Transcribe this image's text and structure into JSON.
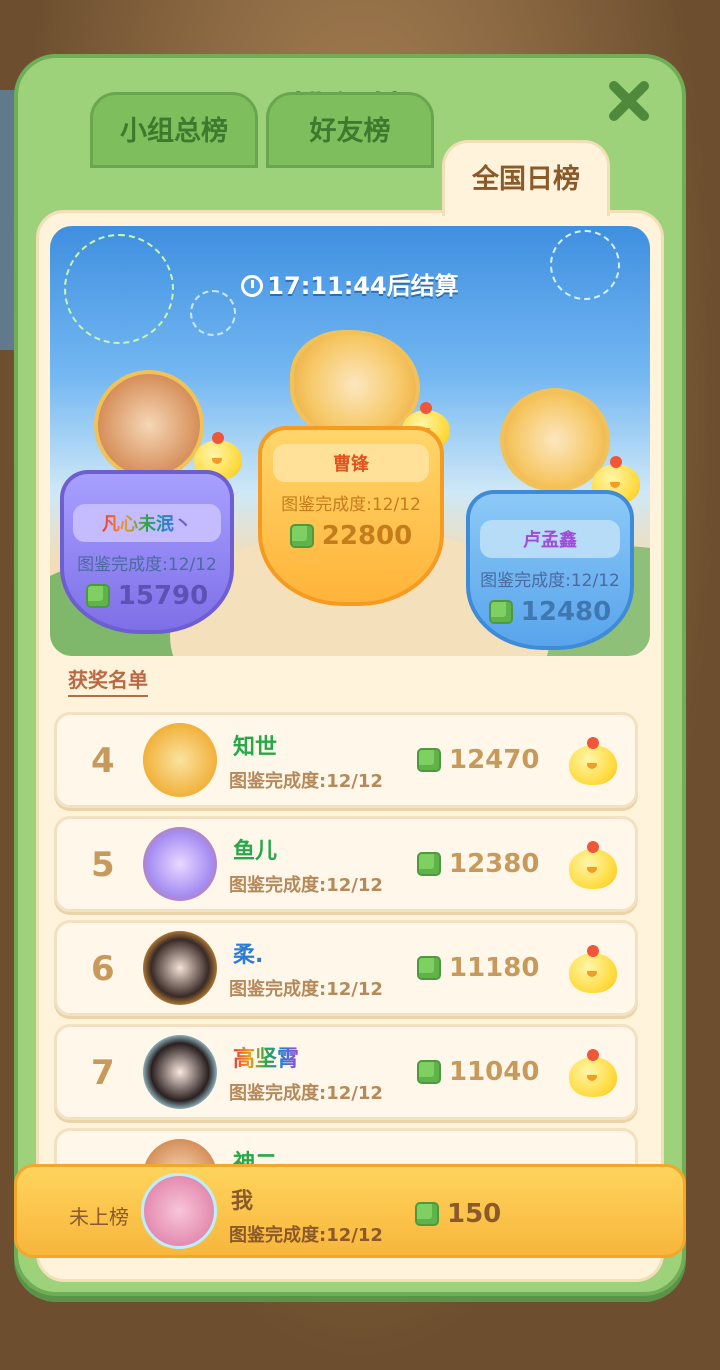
{
  "title": "排行榜",
  "tabs": [
    "小组总榜",
    "好友榜",
    "全国日榜"
  ],
  "active_tab": "全国日榜",
  "timer_text": "17:11:44后结算",
  "podium": [
    {
      "rank": 2,
      "name": "凡心未泯丶",
      "progress": "图鉴完成度:12/12",
      "score": "15790"
    },
    {
      "rank": 1,
      "name": "曹锋",
      "progress": "图鉴完成度:12/12",
      "score": "22800"
    },
    {
      "rank": 3,
      "name": "卢孟鑫",
      "progress": "图鉴完成度:12/12",
      "score": "12480"
    }
  ],
  "winners_label": "获奖名单",
  "list": [
    {
      "rank": "4",
      "name": "知世",
      "progress": "图鉴完成度:12/12",
      "score": "12470",
      "name_color": "#27a84a"
    },
    {
      "rank": "5",
      "name": "鱼儿",
      "progress": "图鉴完成度:12/12",
      "score": "12380",
      "name_color": "#27a84a"
    },
    {
      "rank": "6",
      "name": "柔.",
      "progress": "图鉴完成度:12/12",
      "score": "11180",
      "name_color": "#2d7bd8"
    },
    {
      "rank": "7",
      "name": "高坚霄",
      "progress": "图鉴完成度:12/12",
      "score": "11040",
      "name_color": "rainbow"
    }
  ],
  "partial_row_name": "神二",
  "me": {
    "status": "未上榜",
    "name": "我",
    "progress": "图鉴完成度:12/12",
    "score": "150"
  }
}
